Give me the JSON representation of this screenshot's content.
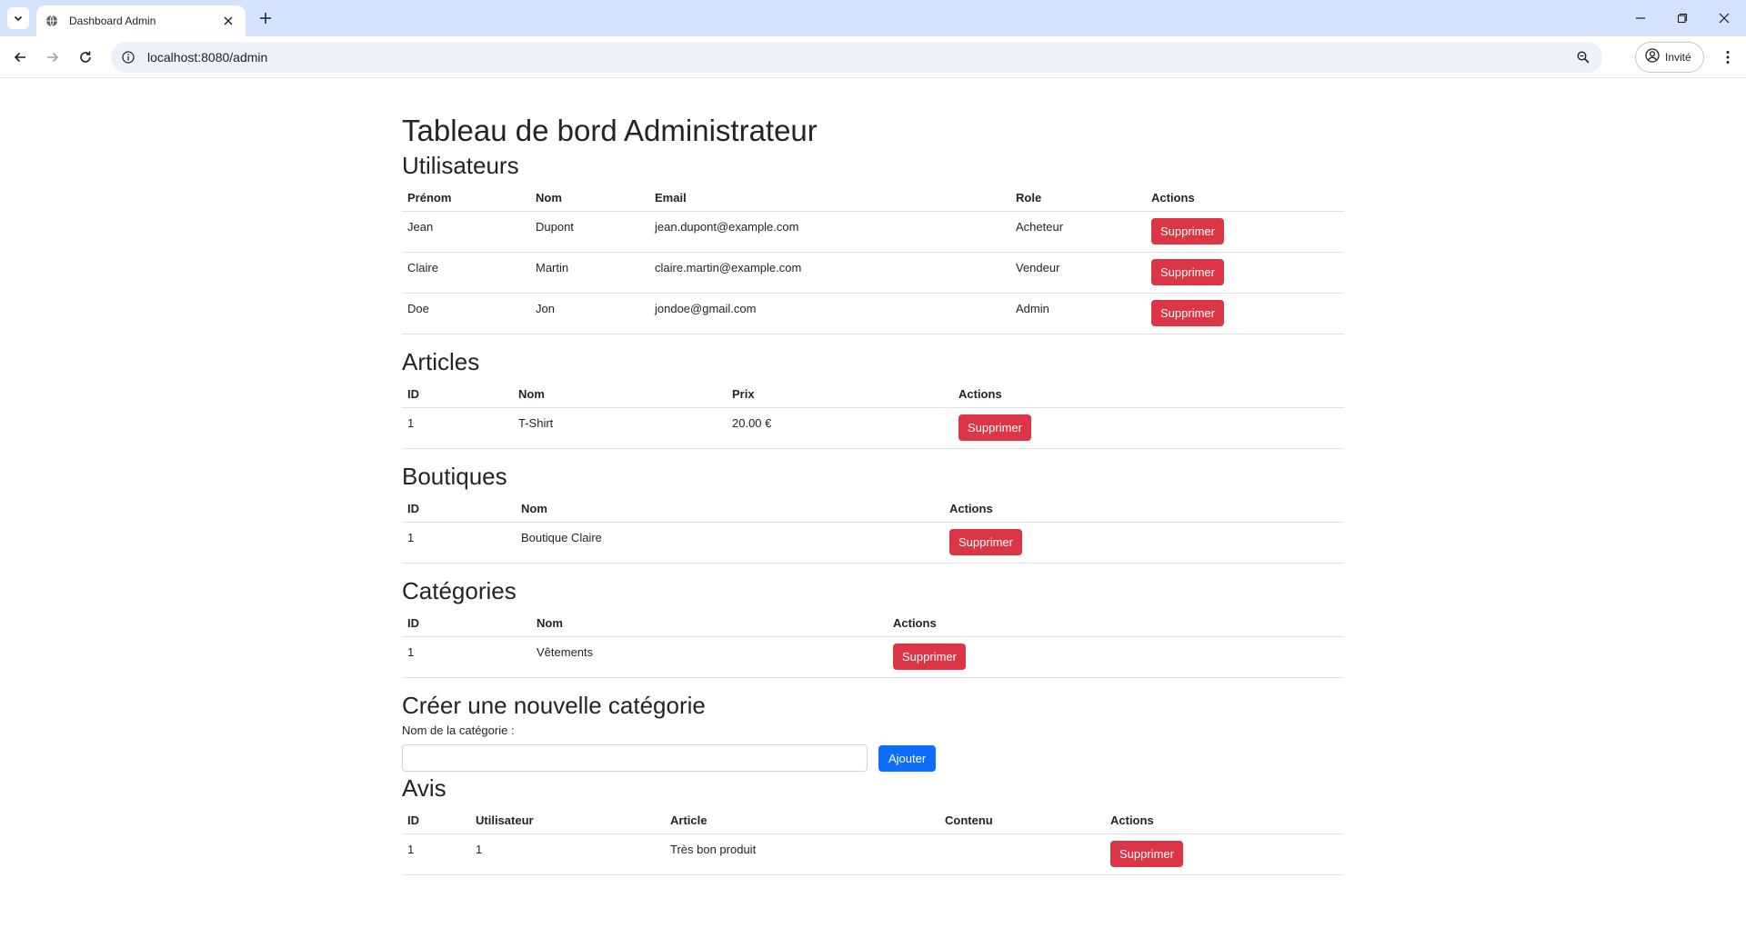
{
  "browser": {
    "tab_title": "Dashboard Admin",
    "url": "localhost:8080/admin",
    "profile_label": "Invité"
  },
  "page": {
    "title": "Tableau de bord Administrateur"
  },
  "users": {
    "heading": "Utilisateurs",
    "columns": [
      "Prénom",
      "Nom",
      "Email",
      "Role",
      "Actions"
    ],
    "rows": [
      {
        "prenom": "Jean",
        "nom": "Dupont",
        "email": "jean.dupont@example.com",
        "role": "Acheteur",
        "action": "Supprimer"
      },
      {
        "prenom": "Claire",
        "nom": "Martin",
        "email": "claire.martin@example.com",
        "role": "Vendeur",
        "action": "Supprimer"
      },
      {
        "prenom": "Doe",
        "nom": "Jon",
        "email": "jondoe@gmail.com",
        "role": "Admin",
        "action": "Supprimer"
      }
    ]
  },
  "articles": {
    "heading": "Articles",
    "columns": [
      "ID",
      "Nom",
      "Prix",
      "Actions"
    ],
    "rows": [
      {
        "id": "1",
        "nom": "T-Shirt",
        "prix": "20.00 €",
        "action": "Supprimer"
      }
    ]
  },
  "boutiques": {
    "heading": "Boutiques",
    "columns": [
      "ID",
      "Nom",
      "Actions"
    ],
    "rows": [
      {
        "id": "1",
        "nom": "Boutique Claire",
        "action": "Supprimer"
      }
    ]
  },
  "categories": {
    "heading": "Catégories",
    "columns": [
      "ID",
      "Nom",
      "Actions"
    ],
    "rows": [
      {
        "id": "1",
        "nom": "Vêtements",
        "action": "Supprimer"
      }
    ]
  },
  "new_category": {
    "heading": "Créer une nouvelle catégorie",
    "label": "Nom de la catégorie :",
    "value": "",
    "submit_label": "Ajouter"
  },
  "avis": {
    "heading": "Avis",
    "columns": [
      "ID",
      "Utilisateur",
      "Article",
      "Contenu",
      "Actions"
    ],
    "rows": [
      {
        "id": "1",
        "utilisateur": "1",
        "article": "Très bon produit",
        "contenu": "",
        "action": "Supprimer"
      }
    ]
  }
}
